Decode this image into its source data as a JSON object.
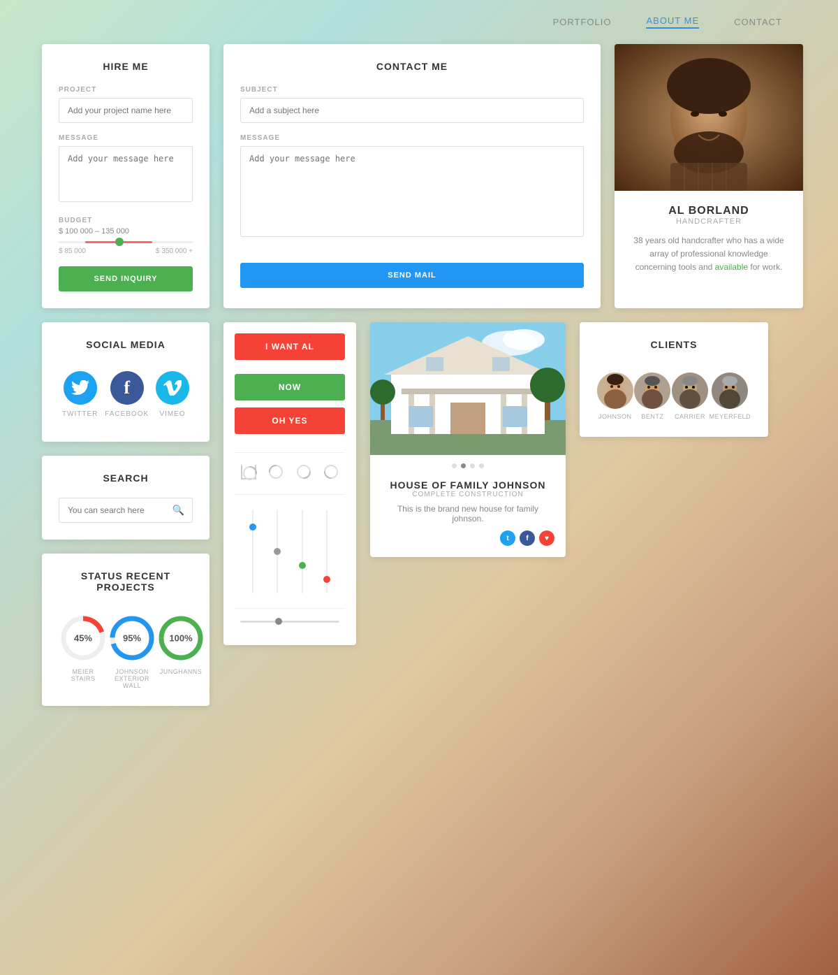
{
  "nav": {
    "items": [
      {
        "id": "portfolio",
        "label": "PORTFOLIO",
        "active": false
      },
      {
        "id": "about-me",
        "label": "ABOUT ME",
        "active": true
      },
      {
        "id": "contact",
        "label": "CONTACT",
        "active": false
      }
    ]
  },
  "hire_me": {
    "title": "HIRE ME",
    "project_label": "PROJECT",
    "project_placeholder": "Add your project name here",
    "message_label": "MESSAGE",
    "message_placeholder": "Add your message here",
    "budget_label": "BUDGET",
    "budget_range": "$ 100 000 – 135 000",
    "budget_min": "$ 85 000",
    "budget_max": "$ 350 000 +",
    "send_button": "SEND INQUIRY"
  },
  "contact_me": {
    "title": "CONTACT ME",
    "subject_label": "SUBJECT",
    "subject_placeholder": "Add a subject here",
    "message_label": "MESSAGE",
    "message_placeholder": "Add your message here",
    "send_button": "SEND MAIL"
  },
  "profile": {
    "name": "AL BORLAND",
    "title": "HANDCRAFTER",
    "description": "38 years old handcrafter who has a wide array of professional knowledge concerning tools and",
    "available_text": "available",
    "available_suffix": " for work."
  },
  "social_media": {
    "title": "SOCIAL MEDIA",
    "items": [
      {
        "id": "twitter",
        "label": "TWITTER",
        "color": "#1da1f2",
        "symbol": "🐦"
      },
      {
        "id": "facebook",
        "label": "FACEBOOK",
        "color": "#3b5998",
        "symbol": "f"
      },
      {
        "id": "vimeo",
        "label": "VIMEO",
        "color": "#1ab7ea",
        "symbol": "V"
      }
    ]
  },
  "buttons": {
    "items": [
      {
        "id": "i-want-al",
        "label": "I WANT AL",
        "color": "red"
      },
      {
        "id": "now",
        "label": "NOW",
        "color": "green"
      },
      {
        "id": "oh-yes",
        "label": "OH YES",
        "color": "red"
      }
    ]
  },
  "portfolio": {
    "title": "HOUSE OF FAMILY JOHNSON",
    "subtitle": "COMPLETE CONSTRUCTION",
    "description": "This is the brand new house for family johnson.",
    "dots": [
      false,
      true,
      false,
      false
    ],
    "socials": [
      {
        "id": "twitter",
        "color": "#1da1f2",
        "symbol": "t"
      },
      {
        "id": "facebook",
        "color": "#3b5998",
        "symbol": "f"
      },
      {
        "id": "heart",
        "color": "#f44336",
        "symbol": "♥"
      }
    ]
  },
  "search": {
    "title": "SEARCH",
    "placeholder": "You can search here"
  },
  "status": {
    "title": "STATUS RECENT PROJECTS",
    "items": [
      {
        "id": "meier",
        "name": "MEIER",
        "sub": "STAIRS",
        "percent": 45,
        "color": "#f44336"
      },
      {
        "id": "johnson",
        "name": "JOHNSON",
        "sub": "EXTERIOR WALL",
        "percent": 95,
        "color": "#2196f3"
      },
      {
        "id": "junghanns",
        "name": "JUNGHANNS",
        "sub": "",
        "percent": 100,
        "color": "#4caf50"
      }
    ]
  },
  "clients": {
    "title": "CLIENTS",
    "items": [
      {
        "id": "johnson",
        "name": "JOHNSON"
      },
      {
        "id": "bentz",
        "name": "BENTZ"
      },
      {
        "id": "carrier",
        "name": "CARRIER"
      },
      {
        "id": "meyerfeld",
        "name": "MEYERFELD"
      }
    ]
  }
}
